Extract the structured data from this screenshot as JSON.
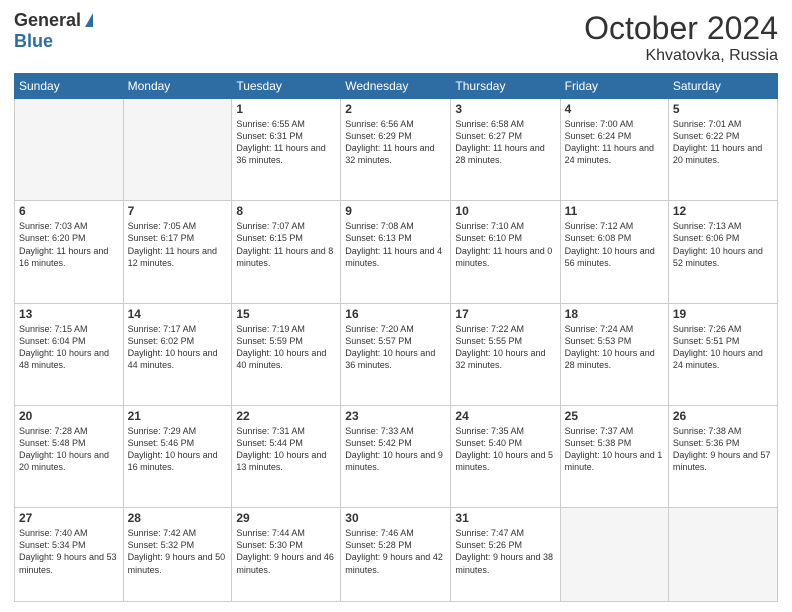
{
  "header": {
    "logo_general": "General",
    "logo_blue": "Blue",
    "month": "October 2024",
    "location": "Khvatovka, Russia"
  },
  "days_of_week": [
    "Sunday",
    "Monday",
    "Tuesday",
    "Wednesday",
    "Thursday",
    "Friday",
    "Saturday"
  ],
  "weeks": [
    [
      {
        "day": "",
        "info": ""
      },
      {
        "day": "",
        "info": ""
      },
      {
        "day": "1",
        "info": "Sunrise: 6:55 AM\nSunset: 6:31 PM\nDaylight: 11 hours and 36 minutes."
      },
      {
        "day": "2",
        "info": "Sunrise: 6:56 AM\nSunset: 6:29 PM\nDaylight: 11 hours and 32 minutes."
      },
      {
        "day": "3",
        "info": "Sunrise: 6:58 AM\nSunset: 6:27 PM\nDaylight: 11 hours and 28 minutes."
      },
      {
        "day": "4",
        "info": "Sunrise: 7:00 AM\nSunset: 6:24 PM\nDaylight: 11 hours and 24 minutes."
      },
      {
        "day": "5",
        "info": "Sunrise: 7:01 AM\nSunset: 6:22 PM\nDaylight: 11 hours and 20 minutes."
      }
    ],
    [
      {
        "day": "6",
        "info": "Sunrise: 7:03 AM\nSunset: 6:20 PM\nDaylight: 11 hours and 16 minutes."
      },
      {
        "day": "7",
        "info": "Sunrise: 7:05 AM\nSunset: 6:17 PM\nDaylight: 11 hours and 12 minutes."
      },
      {
        "day": "8",
        "info": "Sunrise: 7:07 AM\nSunset: 6:15 PM\nDaylight: 11 hours and 8 minutes."
      },
      {
        "day": "9",
        "info": "Sunrise: 7:08 AM\nSunset: 6:13 PM\nDaylight: 11 hours and 4 minutes."
      },
      {
        "day": "10",
        "info": "Sunrise: 7:10 AM\nSunset: 6:10 PM\nDaylight: 11 hours and 0 minutes."
      },
      {
        "day": "11",
        "info": "Sunrise: 7:12 AM\nSunset: 6:08 PM\nDaylight: 10 hours and 56 minutes."
      },
      {
        "day": "12",
        "info": "Sunrise: 7:13 AM\nSunset: 6:06 PM\nDaylight: 10 hours and 52 minutes."
      }
    ],
    [
      {
        "day": "13",
        "info": "Sunrise: 7:15 AM\nSunset: 6:04 PM\nDaylight: 10 hours and 48 minutes."
      },
      {
        "day": "14",
        "info": "Sunrise: 7:17 AM\nSunset: 6:02 PM\nDaylight: 10 hours and 44 minutes."
      },
      {
        "day": "15",
        "info": "Sunrise: 7:19 AM\nSunset: 5:59 PM\nDaylight: 10 hours and 40 minutes."
      },
      {
        "day": "16",
        "info": "Sunrise: 7:20 AM\nSunset: 5:57 PM\nDaylight: 10 hours and 36 minutes."
      },
      {
        "day": "17",
        "info": "Sunrise: 7:22 AM\nSunset: 5:55 PM\nDaylight: 10 hours and 32 minutes."
      },
      {
        "day": "18",
        "info": "Sunrise: 7:24 AM\nSunset: 5:53 PM\nDaylight: 10 hours and 28 minutes."
      },
      {
        "day": "19",
        "info": "Sunrise: 7:26 AM\nSunset: 5:51 PM\nDaylight: 10 hours and 24 minutes."
      }
    ],
    [
      {
        "day": "20",
        "info": "Sunrise: 7:28 AM\nSunset: 5:48 PM\nDaylight: 10 hours and 20 minutes."
      },
      {
        "day": "21",
        "info": "Sunrise: 7:29 AM\nSunset: 5:46 PM\nDaylight: 10 hours and 16 minutes."
      },
      {
        "day": "22",
        "info": "Sunrise: 7:31 AM\nSunset: 5:44 PM\nDaylight: 10 hours and 13 minutes."
      },
      {
        "day": "23",
        "info": "Sunrise: 7:33 AM\nSunset: 5:42 PM\nDaylight: 10 hours and 9 minutes."
      },
      {
        "day": "24",
        "info": "Sunrise: 7:35 AM\nSunset: 5:40 PM\nDaylight: 10 hours and 5 minutes."
      },
      {
        "day": "25",
        "info": "Sunrise: 7:37 AM\nSunset: 5:38 PM\nDaylight: 10 hours and 1 minute."
      },
      {
        "day": "26",
        "info": "Sunrise: 7:38 AM\nSunset: 5:36 PM\nDaylight: 9 hours and 57 minutes."
      }
    ],
    [
      {
        "day": "27",
        "info": "Sunrise: 7:40 AM\nSunset: 5:34 PM\nDaylight: 9 hours and 53 minutes."
      },
      {
        "day": "28",
        "info": "Sunrise: 7:42 AM\nSunset: 5:32 PM\nDaylight: 9 hours and 50 minutes."
      },
      {
        "day": "29",
        "info": "Sunrise: 7:44 AM\nSunset: 5:30 PM\nDaylight: 9 hours and 46 minutes."
      },
      {
        "day": "30",
        "info": "Sunrise: 7:46 AM\nSunset: 5:28 PM\nDaylight: 9 hours and 42 minutes."
      },
      {
        "day": "31",
        "info": "Sunrise: 7:47 AM\nSunset: 5:26 PM\nDaylight: 9 hours and 38 minutes."
      },
      {
        "day": "",
        "info": ""
      },
      {
        "day": "",
        "info": ""
      }
    ]
  ]
}
